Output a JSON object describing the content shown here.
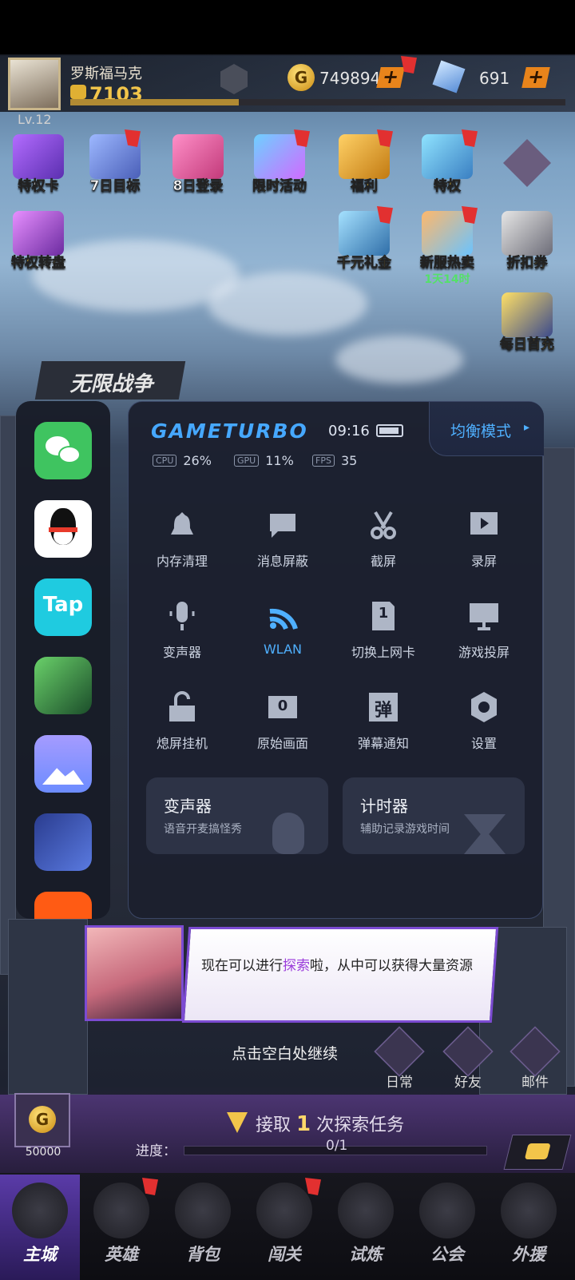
{
  "player": {
    "name": "罗斯福马克",
    "level": "Lv.12",
    "power": "7103",
    "xp_fraction": 0.34
  },
  "resources": {
    "gold": "749894",
    "gems": "691",
    "plus_symbol": "+"
  },
  "events": [
    {
      "label": "特权卡"
    },
    {
      "label": "7日目标"
    },
    {
      "label": "8日登录"
    },
    {
      "label": "限时活动"
    },
    {
      "label": "福利"
    },
    {
      "label": "特权"
    },
    {
      "label": "特权转盘"
    },
    {
      "label": "千元礼金"
    },
    {
      "label": "新服热卖",
      "sub": "1天14时"
    },
    {
      "label": "折扣券"
    },
    {
      "label": "每日首充"
    }
  ],
  "mode_banner": "无限战争",
  "gameturbo": {
    "title": "GAMETURBO",
    "time": "09:16",
    "mode": "均衡模式",
    "mode_arrow": "▸",
    "cpu_tag": "CPU",
    "cpu": "26%",
    "gpu_tag": "GPU",
    "gpu": "11%",
    "fps_tag": "FPS",
    "fps": "35",
    "tools": [
      {
        "label": "内存清理",
        "icon": "bell-icon"
      },
      {
        "label": "消息屏蔽",
        "icon": "message-icon"
      },
      {
        "label": "截屏",
        "icon": "scissors-icon"
      },
      {
        "label": "录屏",
        "icon": "record-icon"
      },
      {
        "label": "变声器",
        "icon": "microphone-icon"
      },
      {
        "label": "WLAN",
        "icon": "wifi-icon"
      },
      {
        "label": "切换上网卡",
        "icon": "sim-card-icon"
      },
      {
        "label": "游戏投屏",
        "icon": "monitor-icon"
      },
      {
        "label": "熄屏挂机",
        "icon": "unlock-icon"
      },
      {
        "label": "原始画面",
        "icon": "original-frame-icon"
      },
      {
        "label": "弹幕通知",
        "icon": "danmaku-icon"
      },
      {
        "label": "设置",
        "icon": "settings-icon"
      }
    ],
    "cards": [
      {
        "title": "变声器",
        "subtitle": "语音开麦搞怪秀"
      },
      {
        "title": "计时器",
        "subtitle": "辅助记录游戏时间"
      }
    ],
    "danmaku_char": "弹",
    "sim_char": "1",
    "orig_char": "0",
    "apps": [
      "wechat-icon",
      "qq-icon",
      "taptap-icon",
      "game-icon",
      "gallery-icon",
      "pixel-game-icon",
      "taobao-icon"
    ],
    "tap_label": "Tap",
    "wlan_color": "#4fb0ff"
  },
  "dialog": {
    "before": "现在可以进行",
    "highlight": "探索",
    "after": "啦，从中可以获得大量资源"
  },
  "continue_hint": "点击空白处继续",
  "side_buttons": [
    {
      "label": "日常"
    },
    {
      "label": "好友"
    },
    {
      "label": "邮件"
    }
  ],
  "task": {
    "prefix": "接取",
    "count": "1",
    "suffix": "次探索任务",
    "progress_label": "进度：",
    "progress_value": "0/1",
    "reward": "50000"
  },
  "nav": [
    {
      "label": "主城"
    },
    {
      "label": "英雄"
    },
    {
      "label": "背包"
    },
    {
      "label": "闯关"
    },
    {
      "label": "试炼"
    },
    {
      "label": "公会"
    },
    {
      "label": "外援"
    }
  ]
}
